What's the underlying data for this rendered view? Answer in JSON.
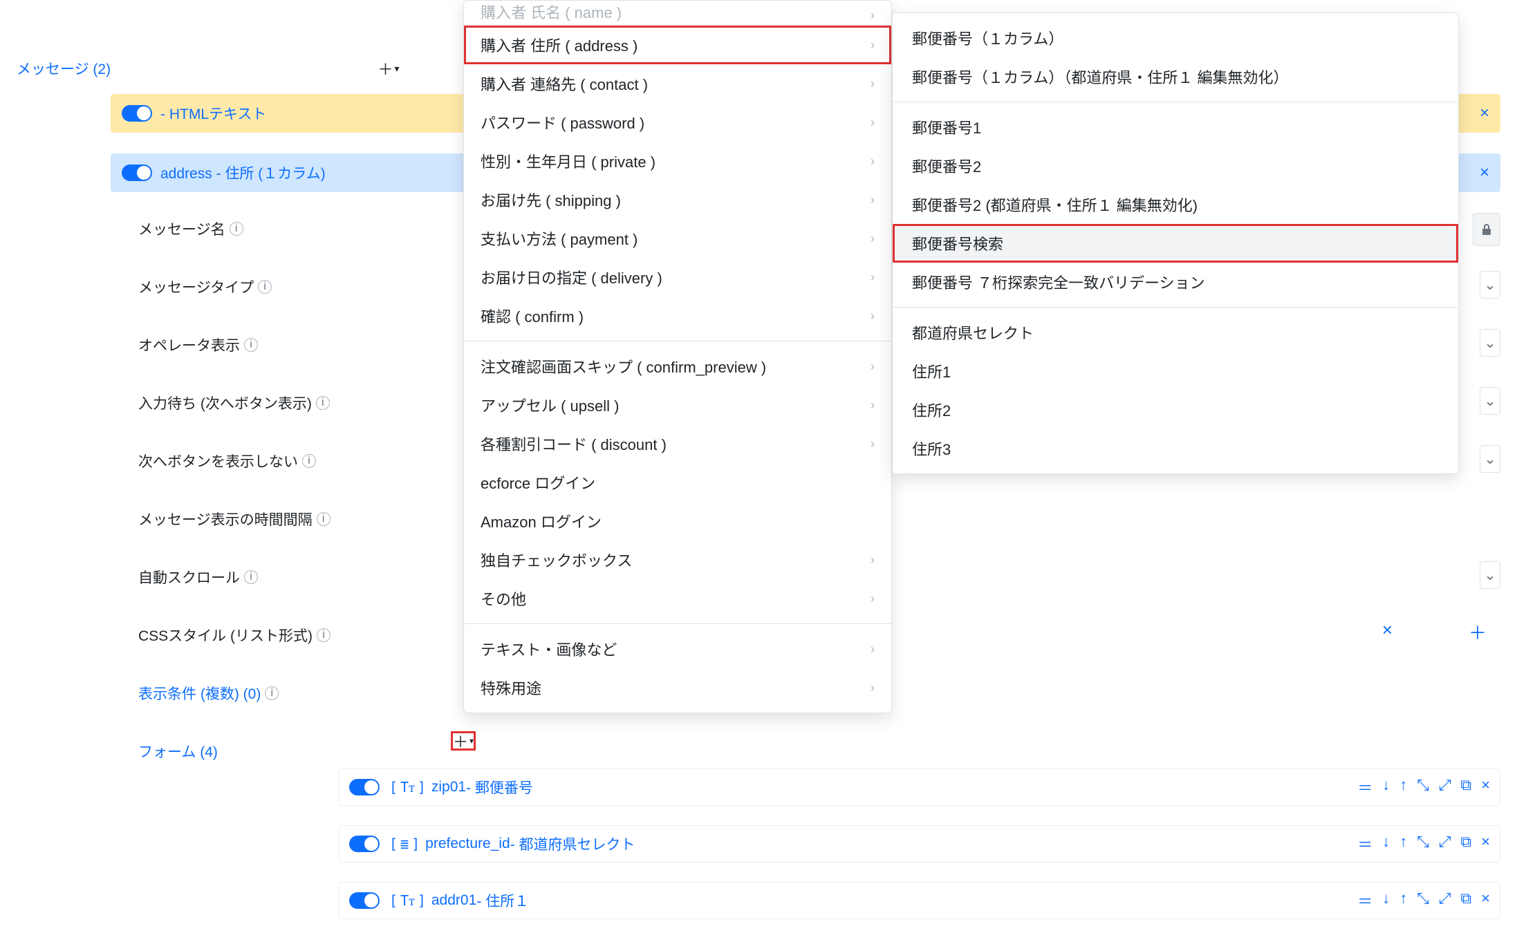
{
  "header": {
    "messages_label": "メッセージ (2)",
    "add_icon": "＋▾"
  },
  "tree": {
    "item1_label": "- HTMLテキスト",
    "item2_label": "address - 住所 (１カラム)"
  },
  "props": {
    "p1": "メッセージ名",
    "p2": "メッセージタイプ",
    "p3": "オペレータ表示",
    "p4": "入力待ち (次へボタン表示)",
    "p5": "次へボタンを表示しない",
    "p6": "メッセージ表示の時間間隔",
    "p7": "自動スクロール",
    "p8": "CSSスタイル (リスト形式)",
    "p9": "表示条件 (複数) (0)",
    "p10": "フォーム (4)"
  },
  "menu1": {
    "m0": "購入者 氏名 ( name )",
    "m1": "購入者 住所 ( address )",
    "m2": "購入者 連絡先 ( contact )",
    "m3": "パスワード ( password )",
    "m4": "性別・生年月日 ( private )",
    "m5": "お届け先 ( shipping )",
    "m6": "支払い方法 ( payment )",
    "m7": "お届け日の指定 ( delivery )",
    "m8": "確認 ( confirm )",
    "m9": "注文確認画面スキップ ( confirm_preview )",
    "m10": "アップセル ( upsell )",
    "m11": "各種割引コード ( discount )",
    "m12": "ecforce ログイン",
    "m13": "Amazon ログイン",
    "m14": "独自チェックボックス",
    "m15": "その他",
    "m16": "テキスト・画像など",
    "m17": "特殊用途"
  },
  "menu2": {
    "s1": "郵便番号（１カラム）",
    "s2": "郵便番号（１カラム）（都道府県・住所１ 編集無効化）",
    "s3": "郵便番号1",
    "s4": "郵便番号2",
    "s5": "郵便番号2 (都道府県・住所１ 編集無効化)",
    "s6": "郵便番号検索",
    "s7": "郵便番号 ７桁探索完全一致バリデーション",
    "s8": "都道府県セレクト",
    "s9": "住所1",
    "s10": "住所2",
    "s11": "住所3"
  },
  "forms": {
    "f1_id": "zip01",
    "f1_name": " - 郵便番号",
    "f2_id": "prefecture_id",
    "f2_name": " - 都道府県セレクト",
    "f3_id": "addr01",
    "f3_name": " - 住所１"
  },
  "glyph": {
    "chev_right": "›",
    "chev_down": "⌄",
    "close": "×",
    "plus": "＋",
    "equals": "＝",
    "arr_down": "↓",
    "arr_up": "↑",
    "expand": "⤢",
    "collapse": "⤡",
    "copy": "⧉",
    "list": "≣",
    "text": "Tᴛ"
  }
}
